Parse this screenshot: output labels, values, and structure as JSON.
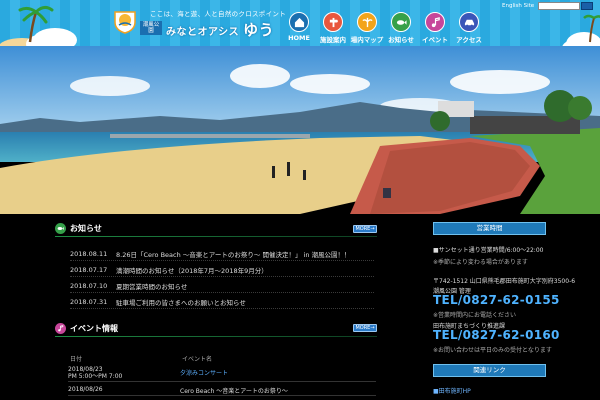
{
  "header": {
    "tagline": "ここは、海と遊、人と自然のクロスポイント",
    "logo_sub": "潮風公園",
    "logo_main": "みなとオアシス",
    "logo_big": "ゆう",
    "english_link": "English Site",
    "search_placeholder": ""
  },
  "gnav": [
    {
      "label": "HOME",
      "icon": "home-icon",
      "color": "#1a6fb0"
    },
    {
      "label": "施設案内",
      "icon": "sign-icon",
      "color": "#e8573e"
    },
    {
      "label": "場内マップ",
      "icon": "palm-icon",
      "color": "#f3a41b"
    },
    {
      "label": "お知らせ",
      "icon": "fish-icon",
      "color": "#36a04a"
    },
    {
      "label": "イベント",
      "icon": "music-icon",
      "color": "#c7469a"
    },
    {
      "label": "アクセス",
      "icon": "car-icon",
      "color": "#3a56b8"
    }
  ],
  "news": {
    "title": "お知らせ",
    "more_label": "MORE→",
    "items": [
      {
        "date": "2018.08.11",
        "title": "8.26日「Cero Beach ～音楽とアートのお祭り～ 開催決定！」 in 潮風公園！！"
      },
      {
        "date": "2018.07.17",
        "title": "満潮時間のお知らせ（2018年7月～2018年9月分）"
      },
      {
        "date": "2018.07.10",
        "title": "夏期営業時間のお知らせ"
      },
      {
        "date": "2018.07.31",
        "title": "駐車場ご利用の皆さまへのお願いとお知らせ"
      }
    ]
  },
  "events": {
    "title": "イベント情報",
    "more_label": "MORE→",
    "col_date": "日付",
    "col_title": "イベント名",
    "items": [
      {
        "date": "2018/08/23\nPM 5:00～PM 7:00",
        "title": "夕涼みコンサート"
      },
      {
        "date": "2018/08/26",
        "title": "Cero Beach ～音楽とアートのお祭り～"
      }
    ]
  },
  "sidebar": {
    "hours_head": "営業時間",
    "hours_text": "■サンセット通り営業時間/6:00～22:00",
    "hours_note": "※季節により変わる場合があります",
    "address": "〒742-1512 山口県熊毛郡田布施町大字別府3500-6",
    "office_label": "潮風公園 管理",
    "tel1": "TEL/0827-62-0155",
    "tel1_note": "※営業時間内にお電話ください",
    "office2_label": "田布施町まちづくり推進課",
    "tel2": "TEL/0827-62-0160",
    "tel2_note": "※お問い合わせは平日のみの受付となります",
    "related_head": "関連リンク",
    "related_item": "■田布施町HP"
  }
}
